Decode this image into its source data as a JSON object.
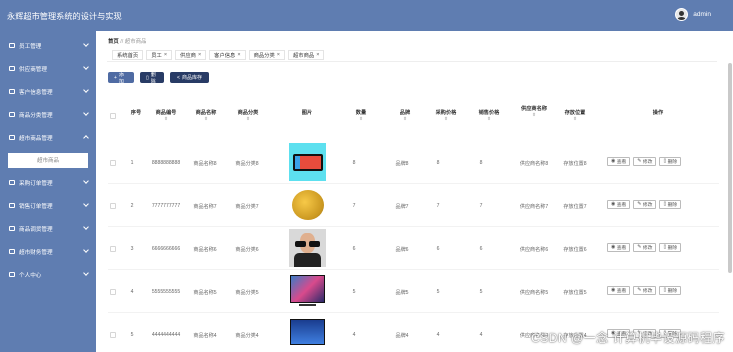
{
  "app": {
    "title": "永辉超市管理系统的设计与实现",
    "user": "admin"
  },
  "sidebar": {
    "items": [
      {
        "label": "员工管理",
        "expanded": false
      },
      {
        "label": "供应商管理",
        "expanded": false
      },
      {
        "label": "客户信息管理",
        "expanded": false
      },
      {
        "label": "商品分类管理",
        "expanded": false
      },
      {
        "label": "超市商品管理",
        "expanded": true,
        "sub": "超市商品"
      },
      {
        "label": "采购订单管理",
        "expanded": false
      },
      {
        "label": "销售订单管理",
        "expanded": false
      },
      {
        "label": "商品调货管理",
        "expanded": false
      },
      {
        "label": "超市财务管理",
        "expanded": false
      },
      {
        "label": "个人中心",
        "expanded": false
      }
    ]
  },
  "breadcrumb": {
    "home": "首页",
    "sep": "//",
    "current": "超市商品"
  },
  "tags": [
    "系统首页",
    "员工",
    "供应商",
    "客户信息",
    "商品分类",
    "超市商品"
  ],
  "toolbar": {
    "add": "添加",
    "delete": "删除",
    "stats": "商品库存"
  },
  "table": {
    "columns": [
      "序号",
      "商品编号",
      "商品名称",
      "商品分类",
      "图片",
      "数量",
      "品牌",
      "采购价格",
      "销售价格",
      "供应商名称",
      "存放位置",
      "操作"
    ],
    "rows": [
      {
        "index": "1",
        "code": "8888888888",
        "name": "商品名称8",
        "category": "商品分类8",
        "image": "tablet",
        "qty": "8",
        "brand": "品牌8",
        "buy": "8",
        "sell": "8",
        "supplier": "供应商名称8",
        "location": "存放位置8"
      },
      {
        "index": "2",
        "code": "7777777777",
        "name": "商品名称7",
        "category": "商品分类7",
        "image": "durian",
        "qty": "7",
        "brand": "品牌7",
        "buy": "7",
        "sell": "7",
        "supplier": "供应商名称7",
        "location": "存放位置7"
      },
      {
        "index": "3",
        "code": "6666666666",
        "name": "商品名称6",
        "category": "商品分类6",
        "image": "sunglasses",
        "qty": "6",
        "brand": "品牌6",
        "buy": "6",
        "sell": "6",
        "supplier": "供应商名称6",
        "location": "存放位置6"
      },
      {
        "index": "4",
        "code": "5555555555",
        "name": "商品名称5",
        "category": "商品分类5",
        "image": "tv",
        "qty": "5",
        "brand": "品牌5",
        "buy": "5",
        "sell": "5",
        "supplier": "供应商名称5",
        "location": "存放位置5"
      },
      {
        "index": "5",
        "code": "4444444444",
        "name": "商品名称4",
        "category": "商品分类4",
        "image": "tv-blue",
        "qty": "4",
        "brand": "品牌4",
        "buy": "4",
        "sell": "4",
        "supplier": "供应商名称4",
        "location": "存放位置4"
      }
    ],
    "ops": {
      "view": "查看",
      "edit": "修改",
      "delete": "删除"
    }
  },
  "watermark": "CSDN @一念 计算机毕设源码程序",
  "colors": {
    "sidebar": "#5f7db1",
    "primary_button": "#283b65"
  }
}
